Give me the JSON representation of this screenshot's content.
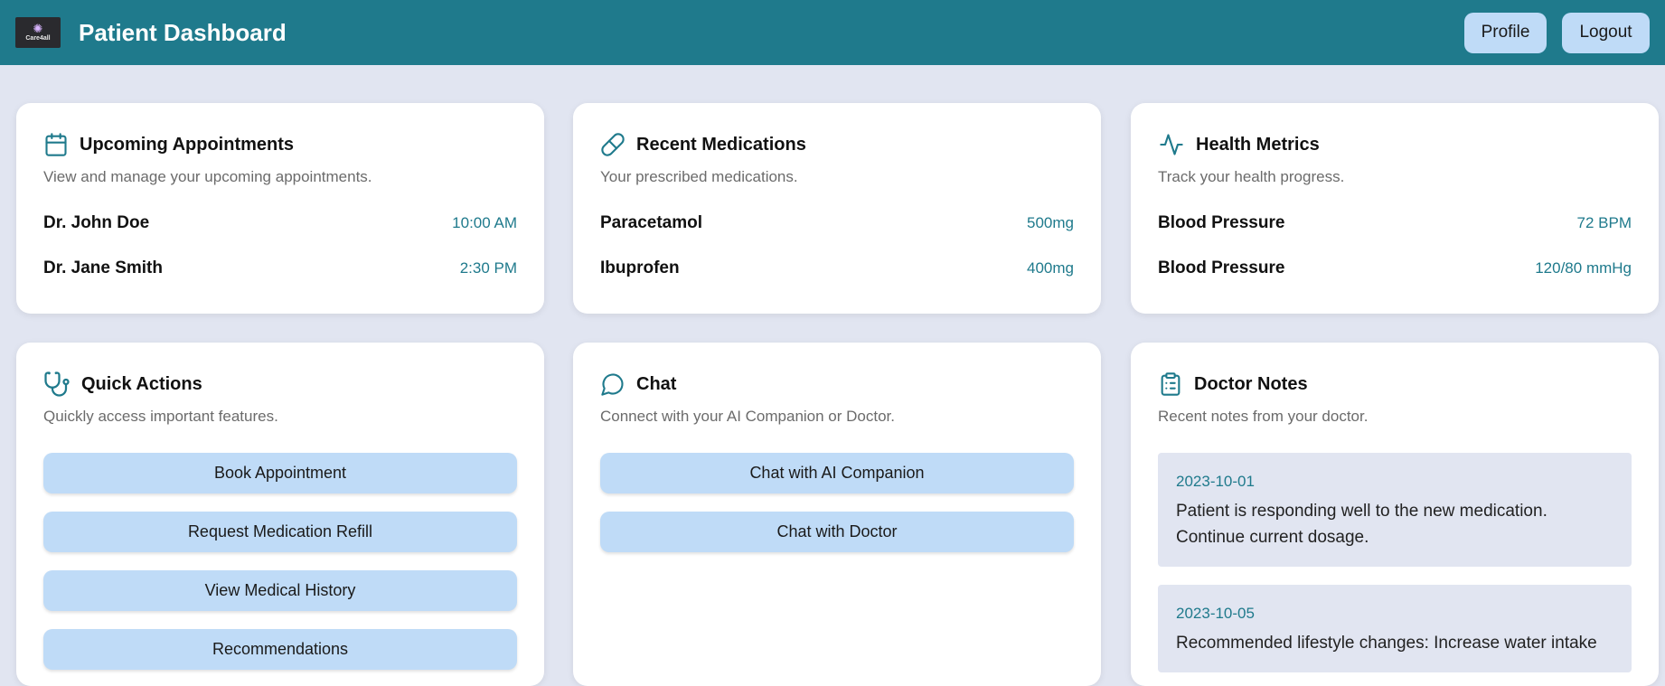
{
  "header": {
    "logo_text": "Care4all",
    "title": "Patient Dashboard",
    "profile_label": "Profile",
    "logout_label": "Logout"
  },
  "colors": {
    "primary": "#1f7a8c",
    "button": "#bfdbf7",
    "background": "#e1e5f1"
  },
  "appointments": {
    "icon": "calendar-icon",
    "title": "Upcoming Appointments",
    "subtitle": "View and manage your upcoming appointments.",
    "items": [
      {
        "name": "Dr. John Doe",
        "time": "10:00 AM"
      },
      {
        "name": "Dr. Jane Smith",
        "time": "2:30 PM"
      }
    ]
  },
  "medications": {
    "icon": "pill-icon",
    "title": "Recent Medications",
    "subtitle": "Your prescribed medications.",
    "items": [
      {
        "name": "Paracetamol",
        "dose": "500mg"
      },
      {
        "name": "Ibuprofen",
        "dose": "400mg"
      }
    ]
  },
  "metrics": {
    "icon": "activity-icon",
    "title": "Health Metrics",
    "subtitle": "Track your health progress.",
    "items": [
      {
        "name": "Blood Pressure",
        "value": "72 BPM"
      },
      {
        "name": "Blood Pressure",
        "value": "120/80 mmHg"
      }
    ]
  },
  "quick_actions": {
    "icon": "stethoscope-icon",
    "title": "Quick Actions",
    "subtitle": "Quickly access important features.",
    "buttons": [
      "Book Appointment",
      "Request Medication Refill",
      "View Medical History",
      "Recommendations"
    ]
  },
  "chat": {
    "icon": "chat-bubble-icon",
    "title": "Chat",
    "subtitle": "Connect with your AI Companion or Doctor.",
    "buttons": [
      "Chat with AI Companion",
      "Chat with Doctor"
    ]
  },
  "doctor_notes": {
    "icon": "clipboard-icon",
    "title": "Doctor Notes",
    "subtitle": "Recent notes from your doctor.",
    "notes": [
      {
        "date": "2023-10-01",
        "text": "Patient is responding well to the new medication. Continue current dosage."
      },
      {
        "date": "2023-10-05",
        "text": "Recommended lifestyle changes: Increase water intake"
      }
    ]
  }
}
